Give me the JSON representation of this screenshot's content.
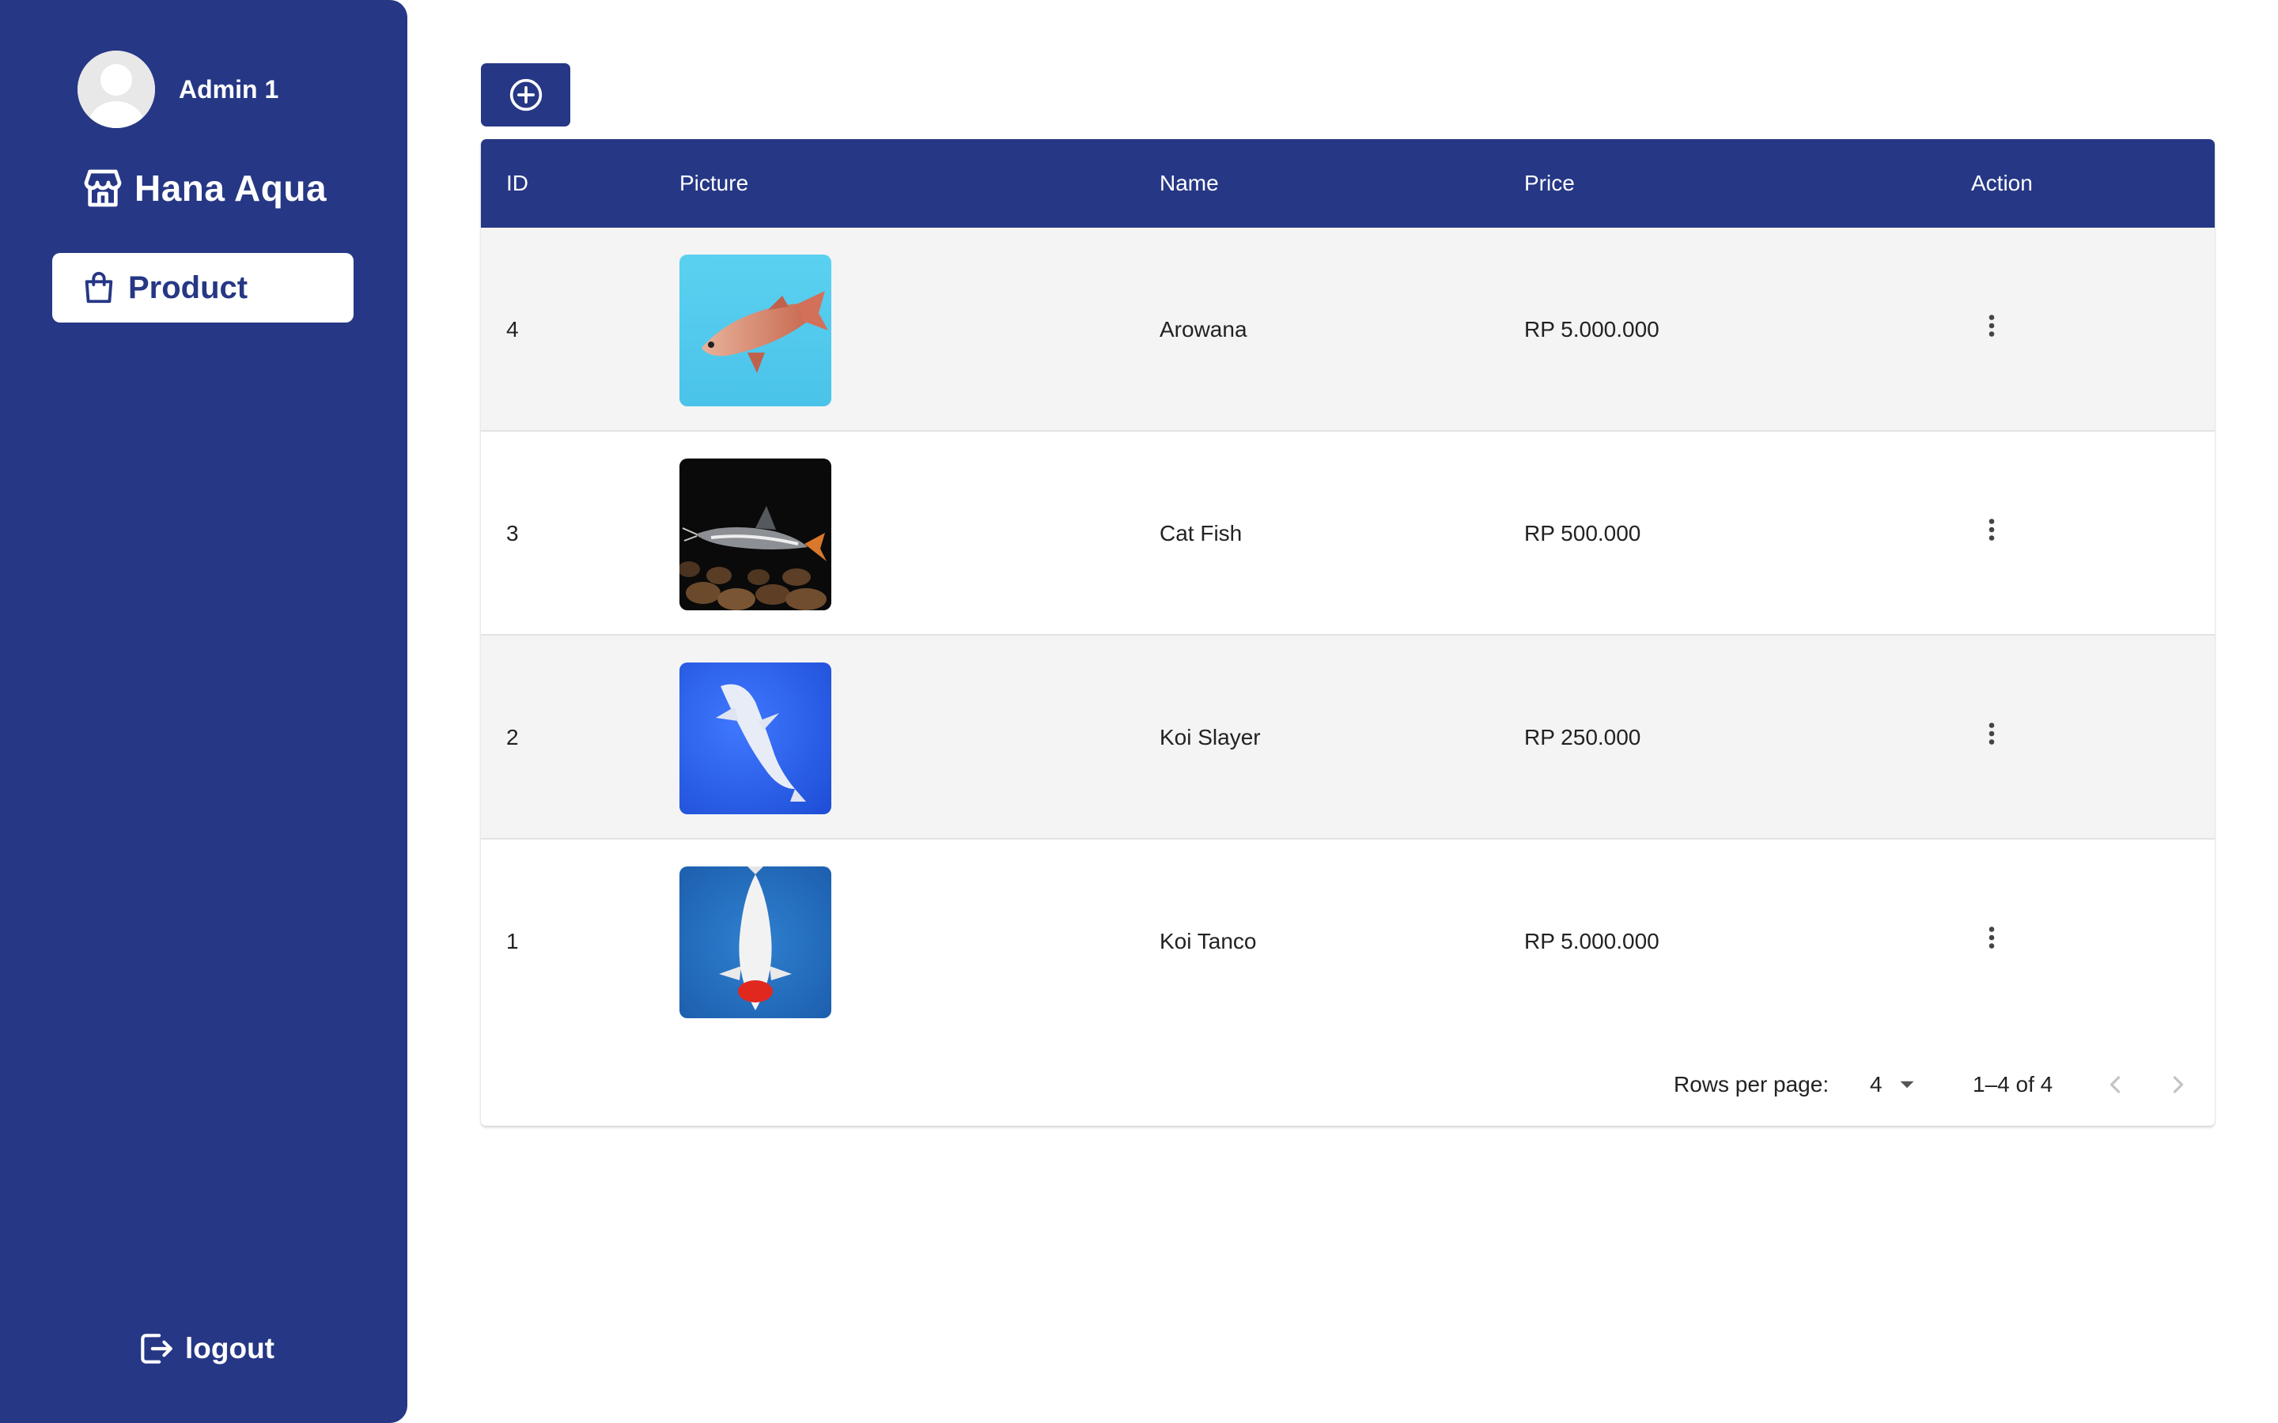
{
  "sidebar": {
    "user_name": "Admin 1",
    "brand_name": "Hana Aqua",
    "nav_product_label": "Product",
    "logout_label": "logout",
    "background_color": "#263785"
  },
  "toolbar": {
    "add_icon": "plus-circle-icon"
  },
  "table": {
    "columns": [
      "ID",
      "Picture",
      "Name",
      "Price",
      "Action"
    ],
    "header_color": "#263785",
    "rows": [
      {
        "id": "4",
        "picture": "arowana-fish-photo",
        "name": "Arowana",
        "price": "RP 5.000.000"
      },
      {
        "id": "3",
        "picture": "cat-fish-photo",
        "name": "Cat Fish",
        "price": "RP 500.000"
      },
      {
        "id": "2",
        "picture": "koi-slayer-photo",
        "name": "Koi Slayer",
        "price": "RP 250.000"
      },
      {
        "id": "1",
        "picture": "koi-tanco-photo",
        "name": "Koi Tanco",
        "price": "RP 5.000.000"
      }
    ]
  },
  "pagination": {
    "rows_per_page_label": "Rows per page:",
    "rows_per_page_value": "4",
    "range_text": "1–4 of 4"
  }
}
